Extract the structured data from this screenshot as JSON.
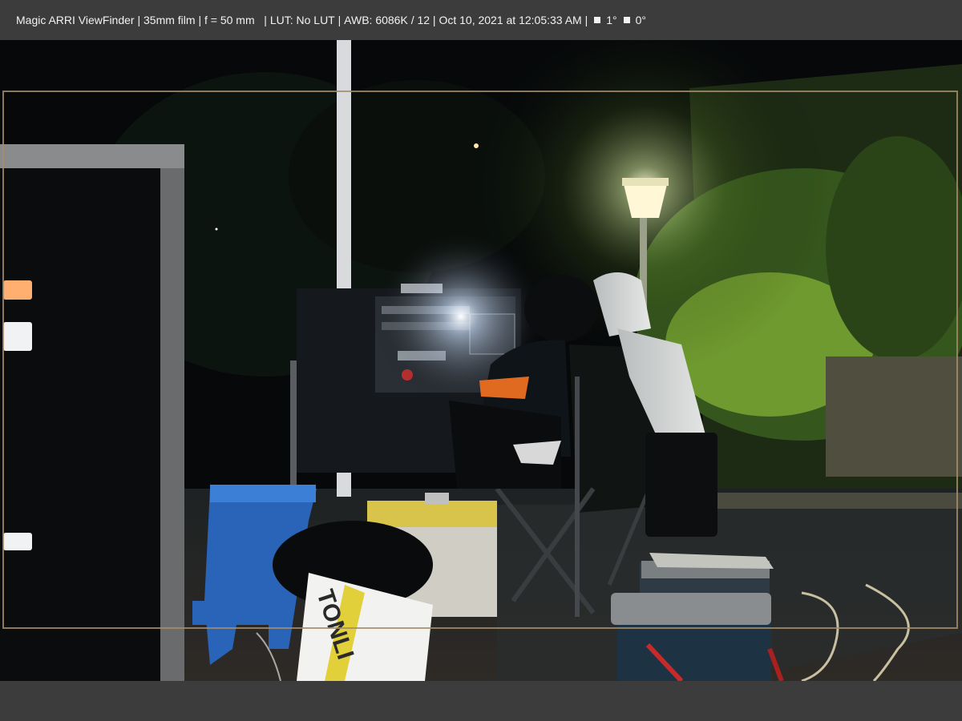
{
  "status": {
    "app_name": "Magic ARRI ViewFinder",
    "format": "35mm film",
    "focal_length": "f = 50 mm",
    "lut": "LUT: No LUT",
    "awb": "AWB: 6086K / 12",
    "datetime": "Oct 10, 2021 at 12:05:33 AM",
    "tilt": "1°",
    "roll": "0°"
  },
  "scene": {
    "bag_text": "TONLI"
  },
  "colors": {
    "bar": "#3c3c3c",
    "text": "#f2f2f2",
    "frame_guide": "#a58c69"
  }
}
